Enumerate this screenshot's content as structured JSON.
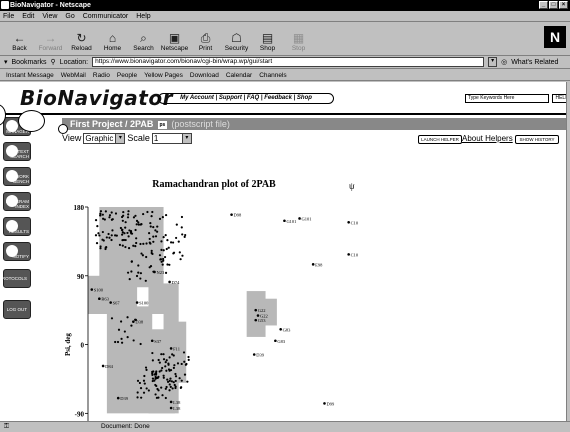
{
  "window": {
    "title": "BioNavigator - Netscape"
  },
  "menu": [
    "File",
    "Edit",
    "View",
    "Go",
    "Communicator",
    "Help"
  ],
  "toolbar": [
    {
      "label": "Back",
      "icon": "back-icon",
      "glyph": "←",
      "disabled": false
    },
    {
      "label": "Forward",
      "icon": "forward-icon",
      "glyph": "→",
      "disabled": true
    },
    {
      "label": "Reload",
      "icon": "reload-icon",
      "glyph": "↻",
      "disabled": false
    },
    {
      "label": "Home",
      "icon": "home-icon",
      "glyph": "⌂",
      "disabled": false
    },
    {
      "label": "Search",
      "icon": "search-icon",
      "glyph": "⌕",
      "disabled": false
    },
    {
      "label": "Netscape",
      "icon": "netscape-icon",
      "glyph": "▣",
      "disabled": false
    },
    {
      "label": "Print",
      "icon": "print-icon",
      "glyph": "⎙",
      "disabled": false
    },
    {
      "label": "Security",
      "icon": "lock-icon",
      "glyph": "☖",
      "disabled": false
    },
    {
      "label": "Shop",
      "icon": "shop-icon",
      "glyph": "▤",
      "disabled": false
    },
    {
      "label": "Stop",
      "icon": "stop-icon",
      "glyph": "▦",
      "disabled": true
    }
  ],
  "netscape_logo": "N",
  "location": {
    "bookmarks_label": "Bookmarks",
    "location_label": "Location:",
    "url": "https://www.bionavigator.com/bionav/cgi-bin/wrap.wp/gui/start",
    "related_label": "What's Related"
  },
  "personal_bar": [
    "Instant Message",
    "WebMail",
    "Radio",
    "People",
    "Yellow Pages",
    "Download",
    "Calendar",
    "Channels"
  ],
  "site": {
    "brand": "BioNavigator",
    "nav": "My Account | Support | FAQ | Feedback | Shop",
    "search_placeholder": "Type Keywords Here",
    "help_label": "HELP"
  },
  "sidebar": [
    {
      "label": "MANAGER",
      "icon": "manager-icon"
    },
    {
      "label": "TEXT SEARCH",
      "icon": "text-search-icon"
    },
    {
      "label": "WORK BENCH",
      "icon": "workbench-icon"
    },
    {
      "label": "PROGRAM INDEX",
      "icon": "program-index-icon"
    },
    {
      "label": "RESULTS",
      "icon": "results-icon"
    },
    {
      "label": "NOTIFY",
      "icon": "notify-icon"
    },
    {
      "label": "PROTOCOLS",
      "icon": "protocols-icon"
    },
    {
      "label": "LOG OUT",
      "icon": "logout-icon"
    }
  ],
  "project": {
    "title": "First Project / 2PAB",
    "ps_badge": "ps",
    "subtitle": "(postscript file)",
    "view_label": "View",
    "view_value": "Graphic",
    "scale_label": "Scale",
    "scale_value": "1",
    "launch_helper": "LAUNCH HELPER",
    "about_helpers": "About Helpers",
    "show_history": "SHOW HISTORY"
  },
  "chart_data": {
    "type": "scatter",
    "title": "Ramachandran plot of 2PAB",
    "ylabel": "Psi, deg",
    "yticks": [
      180,
      90,
      0,
      -90
    ],
    "ylim": [
      -100,
      180
    ],
    "xlim": [
      -180,
      180
    ],
    "labeled_points": [
      {
        "label": "D98",
        "x": 10,
        "y": 170
      },
      {
        "label": "G101",
        "x": 80,
        "y": 162
      },
      {
        "label": "G101",
        "x": 100,
        "y": 165
      },
      {
        "label": "C10",
        "x": 165,
        "y": 160
      },
      {
        "label": "C10",
        "x": 165,
        "y": 118
      },
      {
        "label": "E98",
        "x": 118,
        "y": 105
      },
      {
        "label": "S100",
        "x": -175,
        "y": 72
      },
      {
        "label": "R63",
        "x": -165,
        "y": 60
      },
      {
        "label": "S67",
        "x": -150,
        "y": 55
      },
      {
        "label": "S100",
        "x": -115,
        "y": 55
      },
      {
        "label": "D74",
        "x": -72,
        "y": 82
      },
      {
        "label": "N23",
        "x": -92,
        "y": 95
      },
      {
        "label": "G22",
        "x": 42,
        "y": 45
      },
      {
        "label": "G22",
        "x": 45,
        "y": 38
      },
      {
        "label": "G53",
        "x": 42,
        "y": 32
      },
      {
        "label": "G83",
        "x": 75,
        "y": 20
      },
      {
        "label": "G83",
        "x": 68,
        "y": 5
      },
      {
        "label": "D39",
        "x": 40,
        "y": -13
      },
      {
        "label": "D99",
        "x": 133,
        "y": -77
      },
      {
        "label": "D38",
        "x": -120,
        "y": 30
      },
      {
        "label": "S37",
        "x": -95,
        "y": 5
      },
      {
        "label": "F11",
        "x": -70,
        "y": -5
      },
      {
        "label": "D84",
        "x": -160,
        "y": -28
      },
      {
        "label": "D39",
        "x": -140,
        "y": -70
      },
      {
        "label": "L38",
        "x": -70,
        "y": -75
      },
      {
        "label": "L38",
        "x": -70,
        "y": -83
      }
    ]
  },
  "status": {
    "text": "Document: Done"
  }
}
